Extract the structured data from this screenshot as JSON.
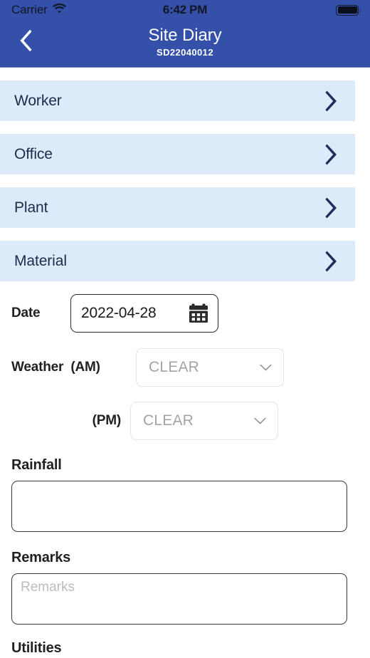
{
  "status_bar": {
    "carrier": "Carrier",
    "wifi_icon": "wifi-icon",
    "time": "6:42 PM",
    "battery_icon": "battery-full-icon"
  },
  "nav_bar": {
    "back_icon": "chevron-left-icon",
    "title": "Site Diary",
    "subtitle": "SD22040012",
    "background_color": "#3450a8"
  },
  "cards": [
    {
      "label": "Worker",
      "chevron_icon": "chevron-right-icon"
    },
    {
      "label": "Office",
      "chevron_icon": "chevron-right-icon"
    },
    {
      "label": "Plant",
      "chevron_icon": "chevron-right-icon"
    },
    {
      "label": "Material",
      "chevron_icon": "chevron-right-icon"
    }
  ],
  "card_style": {
    "background_color": "#ddeaf9",
    "text_color": "#1c2b4a"
  },
  "form": {
    "date": {
      "label": "Date",
      "value": "2022-04-28",
      "calendar_icon": "calendar-icon"
    },
    "weather_am": {
      "label": "Weather",
      "sublabel": "(AM)",
      "value": "CLEAR",
      "chevron_icon": "chevron-down-icon"
    },
    "weather_pm": {
      "label": "(PM)",
      "value": "CLEAR",
      "chevron_icon": "chevron-down-icon"
    },
    "rainfall": {
      "label": "Rainfall",
      "value": "",
      "placeholder": ""
    },
    "remarks": {
      "label": "Remarks",
      "value": "",
      "placeholder": "Remarks"
    },
    "utilities": {
      "label": "Utilities"
    }
  }
}
